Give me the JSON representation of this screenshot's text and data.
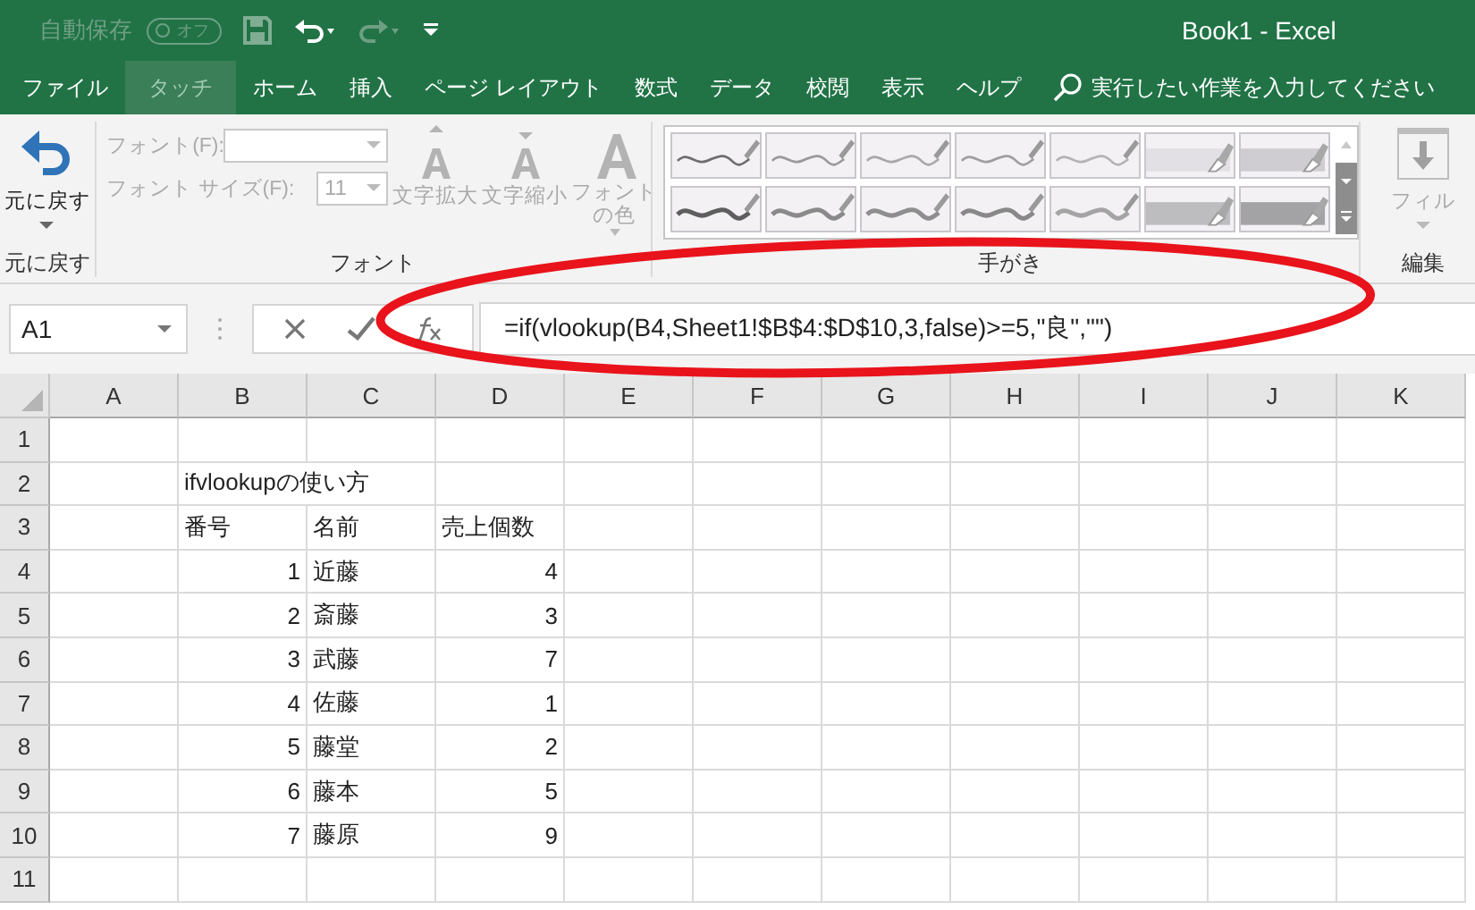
{
  "title_bar": {
    "autosave_label": "自動保存",
    "autosave_toggle": {
      "label": "オフ",
      "on": false
    },
    "title": "Book1  -  Excel"
  },
  "menu_tabs": [
    {
      "label": "ファイル",
      "selected": false
    },
    {
      "label": "タッチ",
      "selected": true
    },
    {
      "label": "ホーム",
      "selected": false
    },
    {
      "label": "挿入",
      "selected": false
    },
    {
      "label": "ページ レイアウト",
      "selected": false
    },
    {
      "label": "数式",
      "selected": false
    },
    {
      "label": "データ",
      "selected": false
    },
    {
      "label": "校閲",
      "selected": false
    },
    {
      "label": "表示",
      "selected": false
    },
    {
      "label": "ヘルプ",
      "selected": false
    }
  ],
  "search": {
    "placeholder": "実行したい作業を入力してください"
  },
  "ribbon": {
    "undo_group": {
      "button": "元に戻す",
      "label": "元に戻す"
    },
    "font_group": {
      "disabled": true,
      "font_label": "フォント(F):",
      "size_label": "フォント サイズ(F):",
      "size_value": "11",
      "grow": "文字拡大",
      "shrink": "文字縮小",
      "color_button": "フォントの色",
      "label": "フォント"
    },
    "ink_group": {
      "label": "手がき",
      "pens": [
        {
          "kind": "pen"
        },
        {
          "kind": "pen"
        },
        {
          "kind": "pen"
        },
        {
          "kind": "pen"
        },
        {
          "kind": "pen"
        },
        {
          "kind": "highlighter"
        },
        {
          "kind": "highlighter"
        },
        {
          "kind": "pen"
        },
        {
          "kind": "pen"
        },
        {
          "kind": "pen"
        },
        {
          "kind": "pen"
        },
        {
          "kind": "pen"
        },
        {
          "kind": "highlighter"
        },
        {
          "kind": "highlighter"
        }
      ]
    },
    "edit_group": {
      "button": "フィル",
      "label": "編集"
    }
  },
  "formula_bar": {
    "name_box": "A1",
    "formula": "=if(vlookup(B4,Sheet1!$B$4:$D$10,3,false)>=5,\"良\",\"\")"
  },
  "sheet": {
    "columns": [
      "A",
      "B",
      "C",
      "D",
      "E",
      "F",
      "G",
      "H",
      "I",
      "J",
      "K"
    ],
    "rows": [
      {
        "header": "1"
      },
      {
        "header": "2",
        "b": {
          "text": "ifvlookupの使い方",
          "kind": "text"
        }
      },
      {
        "header": "3",
        "b": {
          "text": "番号",
          "kind": "text"
        },
        "c": {
          "text": "名前",
          "kind": "text"
        },
        "d": {
          "text": "売上個数",
          "kind": "text"
        }
      },
      {
        "header": "4",
        "b": {
          "text": "1",
          "kind": "number"
        },
        "c": {
          "text": "近藤",
          "kind": "text"
        },
        "d": {
          "text": "4",
          "kind": "number"
        }
      },
      {
        "header": "5",
        "b": {
          "text": "2",
          "kind": "number"
        },
        "c": {
          "text": "斎藤",
          "kind": "text"
        },
        "d": {
          "text": "3",
          "kind": "number"
        }
      },
      {
        "header": "6",
        "b": {
          "text": "3",
          "kind": "number"
        },
        "c": {
          "text": "武藤",
          "kind": "text"
        },
        "d": {
          "text": "7",
          "kind": "number"
        }
      },
      {
        "header": "7",
        "b": {
          "text": "4",
          "kind": "number"
        },
        "c": {
          "text": "佐藤",
          "kind": "text"
        },
        "d": {
          "text": "1",
          "kind": "number"
        }
      },
      {
        "header": "8",
        "b": {
          "text": "5",
          "kind": "number"
        },
        "c": {
          "text": "藤堂",
          "kind": "text"
        },
        "d": {
          "text": "2",
          "kind": "number"
        }
      },
      {
        "header": "9",
        "b": {
          "text": "6",
          "kind": "number"
        },
        "c": {
          "text": "藤本",
          "kind": "text"
        },
        "d": {
          "text": "5",
          "kind": "number"
        }
      },
      {
        "header": "10",
        "b": {
          "text": "7",
          "kind": "number"
        },
        "c": {
          "text": "藤原",
          "kind": "text"
        },
        "d": {
          "text": "9",
          "kind": "number"
        }
      },
      {
        "header": "11"
      }
    ]
  }
}
